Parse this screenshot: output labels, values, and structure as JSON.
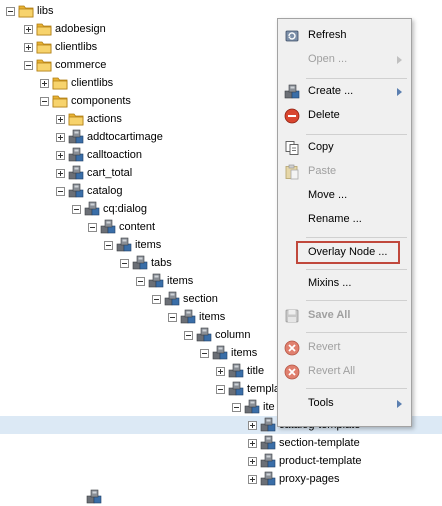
{
  "tree": {
    "libs": "libs",
    "adobesign": "adobesign",
    "clientlibs": "clientlibs",
    "commerce": "commerce",
    "commerce_clientlibs": "clientlibs",
    "components": "components",
    "actions": "actions",
    "addtocartimage": "addtocartimage",
    "calltoaction": "calltoaction",
    "cart_total": "cart_total",
    "catalog": "catalog",
    "cq_dialog": "cq:dialog",
    "content": "content",
    "items1": "items",
    "tabs": "tabs",
    "items2": "items",
    "section": "section",
    "items3": "items",
    "column": "column",
    "items4": "items",
    "title": "title",
    "template": "templa",
    "items5": "ite",
    "catalog_template": "catalog-template",
    "section_template": "section-template",
    "product_template": "product-template",
    "proxy_pages": "proxy-pages"
  },
  "menu": {
    "refresh": "Refresh",
    "open": "Open ...",
    "create": "Create ...",
    "delete": "Delete",
    "copy": "Copy",
    "paste": "Paste",
    "move": "Move ...",
    "rename": "Rename ...",
    "overlay": "Overlay Node ...",
    "mixins": "Mixins ...",
    "save_all": "Save All",
    "revert": "Revert",
    "revert_all": "Revert All",
    "tools": "Tools"
  },
  "colors": {
    "selection": "#dce9f5",
    "highlight_border": "#c0483c",
    "folder": "#f2c14b"
  }
}
